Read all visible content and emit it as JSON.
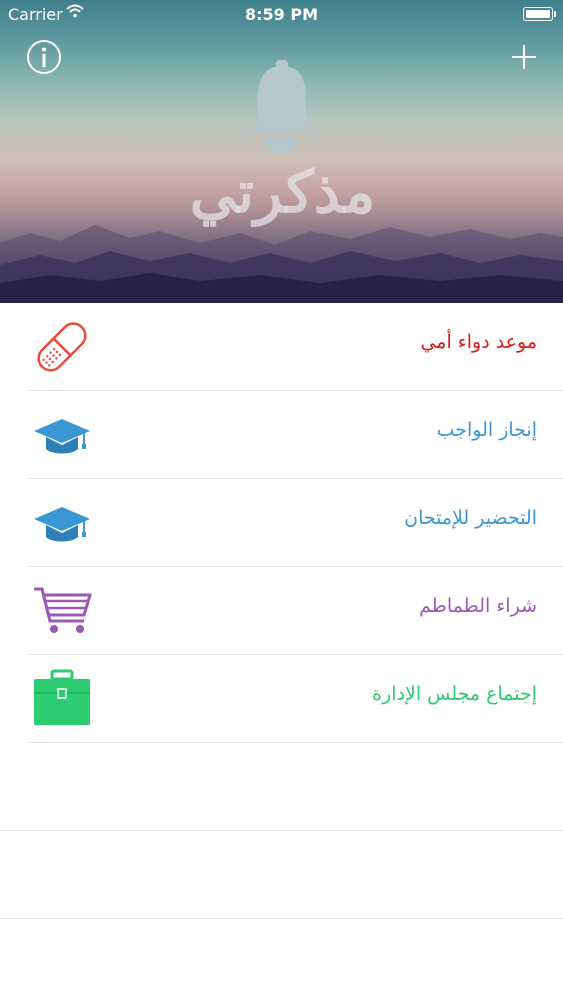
{
  "status_bar": {
    "carrier": "Carrier",
    "time": "8:59 PM"
  },
  "header": {
    "logo_text": "مذكرتي"
  },
  "reminders": [
    {
      "label": "موعد دواء أمي",
      "icon": "pill-icon",
      "color": "#d91d1d"
    },
    {
      "label": "إنجاز الواجب",
      "icon": "graduation-cap-icon",
      "color": "#3a97d4"
    },
    {
      "label": "التحضير للإمتحان",
      "icon": "graduation-cap-icon",
      "color": "#3a97d4"
    },
    {
      "label": "شراء الطماطم",
      "icon": "shopping-cart-icon",
      "color": "#9b59b6"
    },
    {
      "label": "إجتماع مجلس الإدارة",
      "icon": "briefcase-icon",
      "color": "#2ecc71"
    }
  ]
}
